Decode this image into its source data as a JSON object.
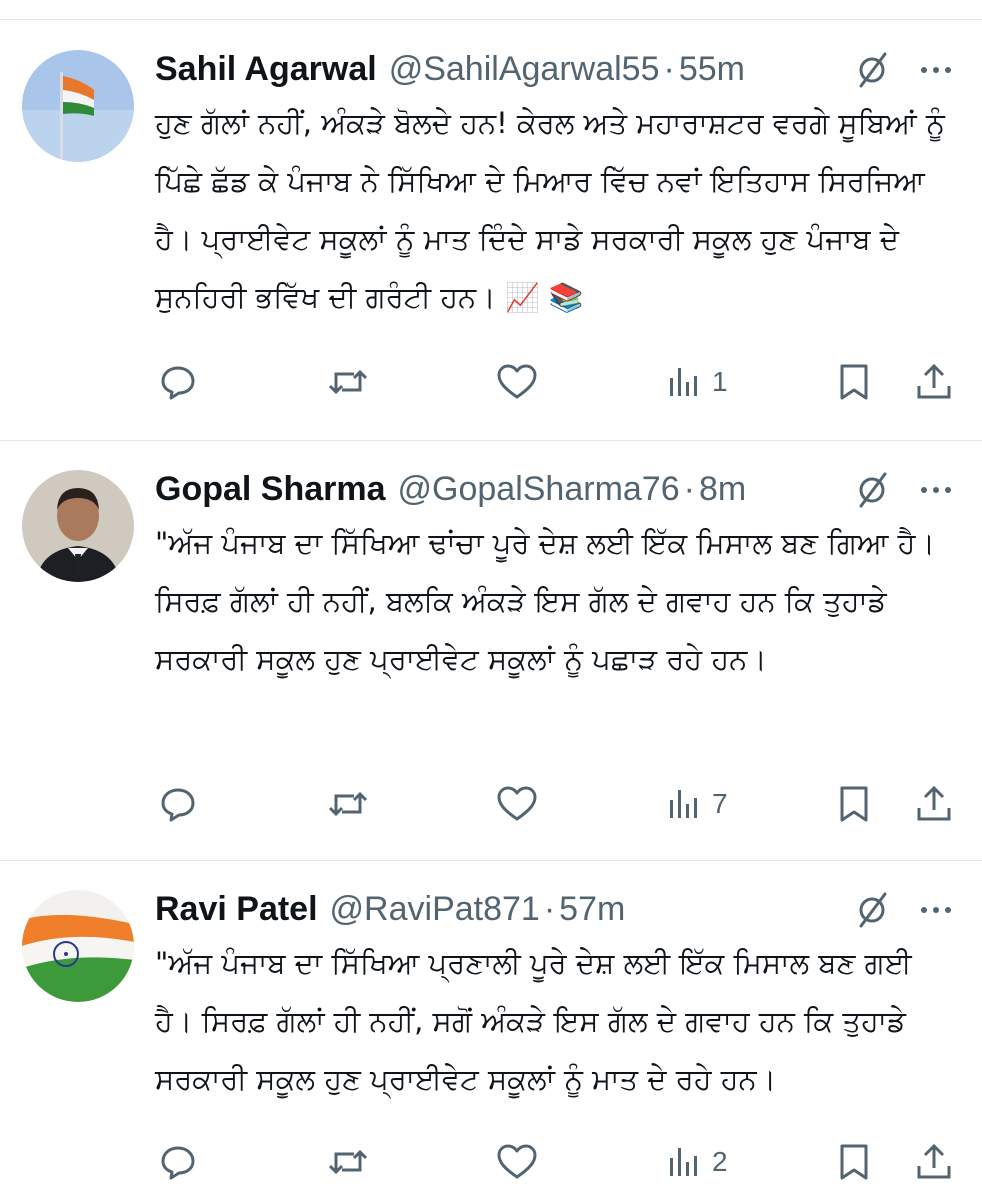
{
  "tweets": [
    {
      "name": "Sahil Agarwal",
      "handle": "@SahilAgarwal55",
      "separator": "·",
      "time": "55m",
      "text": "ਹੁਣ ਗੱਲਾਂ ਨਹੀਂ, ਅੰਕੜੇ ਬੋਲਦੇ ਹਨ! ਕੇਰਲ ਅਤੇ ਮਹਾਰਾਸ਼ਟਰ ਵਰਗੇ ਸੂਬਿਆਂ ਨੂੰ ਪਿੱਛੇ ਛੱਡ ਕੇ ਪੰਜਾਬ ਨੇ ਸਿੱਖਿਆ ਦੇ ਮਿਆਰ ਵਿੱਚ ਨਵਾਂ ਇਤਿਹਾਸ ਸਿਰਜਿਆ ਹੈ। ਪ੍ਰਾਈਵੇਟ ਸਕੂਲਾਂ ਨੂੰ ਮਾਤ ਦਿੰਦੇ ਸਾਡੇ ਸਰਕਾਰੀ ਸਕੂਲ ਹੁਣ ਪੰਜਾਬ ਦੇ ਸੁਨਹਿਰੀ ਭਵਿੱਖ ਦੀ ਗਰੰਟੀ ਹਨ।",
      "emojis": "📈 📚",
      "views": "1",
      "avatar": "flag-pole"
    },
    {
      "name": "Gopal Sharma",
      "handle": "@GopalSharma76",
      "separator": "·",
      "time": "8m",
      "text": "\"ਅੱਜ ਪੰਜਾਬ ਦਾ ਸਿੱਖਿਆ ਢਾਂਚਾ ਪੂਰੇ ਦੇਸ਼ ਲਈ ਇੱਕ ਮਿਸਾਲ ਬਣ ਗਿਆ ਹੈ। ਸਿਰਫ਼ ਗੱਲਾਂ ਹੀ ਨਹੀਂ, ਬਲਕਿ ਅੰਕੜੇ ਇਸ ਗੱਲ ਦੇ ਗਵਾਹ ਹਨ ਕਿ ਤੁਹਾਡੇ ਸਰਕਾਰੀ ਸਕੂਲ ਹੁਣ ਪ੍ਰਾਈਵੇਟ ਸਕੂਲਾਂ ਨੂੰ ਪਛਾੜ ਰਹੇ ਹਨ।",
      "emojis": "",
      "views": "7",
      "avatar": "portrait"
    },
    {
      "name": "Ravi Patel",
      "handle": "@RaviPat871",
      "separator": "·",
      "time": "57m",
      "text": "\"ਅੱਜ ਪੰਜਾਬ ਦਾ ਸਿੱਖਿਆ ਪ੍ਰਣਾਲੀ ਪੂਰੇ ਦੇਸ਼ ਲਈ ਇੱਕ ਮਿਸਾਲ ਬਣ ਗਈ ਹੈ। ਸਿਰਫ਼ ਗੱਲਾਂ ਹੀ ਨਹੀਂ, ਸਗੋਂ ਅੰਕੜੇ ਇਸ ਗੱਲ ਦੇ ਗਵਾਹ ਹਨ ਕਿ ਤੁਹਾਡੇ ਸਰਕਾਰੀ ਸਕੂਲ ਹੁਣ ਪ੍ਰਾਈਵੇਟ ਸਕੂਲਾਂ ਨੂੰ ਮਾਤ ਦੇ ਰਹੇ ਹਨ।",
      "emojis": "",
      "views": "2",
      "avatar": "flag-wave"
    }
  ],
  "icons": {
    "reply": "reply-icon",
    "repost": "repost-icon",
    "like": "like-icon",
    "views": "views-icon",
    "bookmark": "bookmark-icon",
    "share": "share-icon",
    "grok": "grok-icon",
    "more": "more-icon"
  },
  "colors": {
    "text": "#0f1419",
    "muted": "#536471",
    "divider": "#e6e9eb"
  }
}
